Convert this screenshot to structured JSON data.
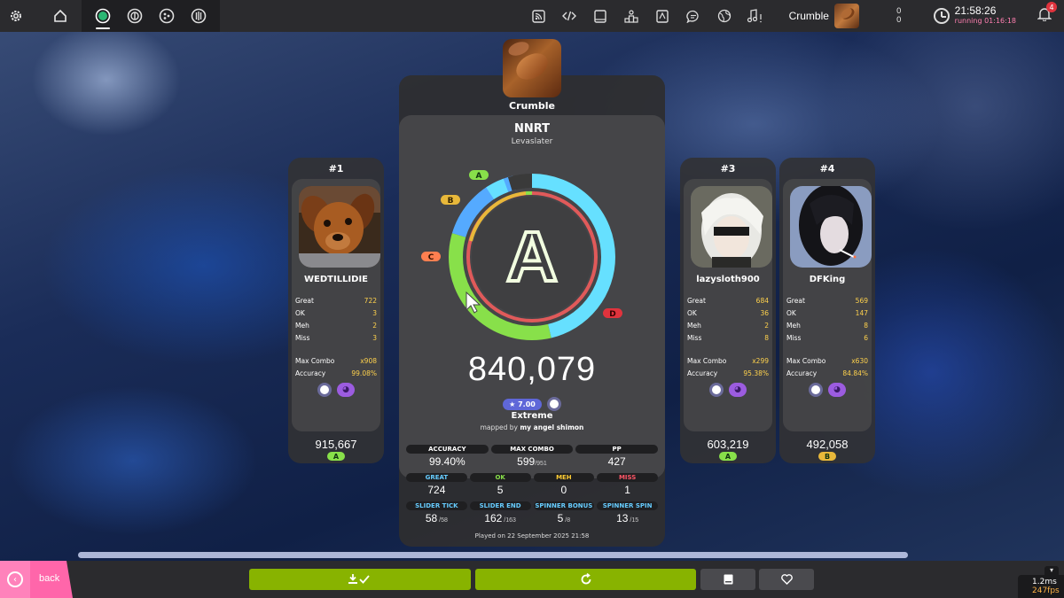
{
  "topbar": {
    "settings_icon": "gear-icon",
    "home_icon": "home-icon",
    "rulesets": [
      "osu-ruleset",
      "taiko-ruleset",
      "catch-ruleset",
      "mania-ruleset"
    ],
    "center_icons": [
      "rss-icon",
      "code-icon",
      "book-icon",
      "ranking-icon",
      "wiki-icon",
      "chat-icon",
      "globe-icon",
      "music-icon"
    ],
    "user": {
      "name": "Crumble"
    },
    "counts": [
      "0",
      "0"
    ],
    "clock": {
      "time": "21:58:26",
      "running": "running 01:16:18"
    },
    "notifications": "4"
  },
  "beatmap": {
    "cover_title": "Crumble",
    "title": "NNRT",
    "artist": "Levaslater",
    "star_rating": "★ 7.00",
    "difficulty": "Extreme",
    "mapped_by_prefix": "mapped by",
    "mapper": "my angel shimon"
  },
  "main_score": {
    "grade": "A",
    "score": "840,079",
    "accuracy_ring": 0.994,
    "grade_markers": [
      "A",
      "B",
      "C",
      "D"
    ],
    "stats_row1": [
      {
        "label": "ACCURACY",
        "value": "99.40%",
        "sub": "",
        "color": "#ffffff"
      },
      {
        "label": "MAX COMBO",
        "value": "599",
        "sub": "/951",
        "color": "#ffffff"
      },
      {
        "label": "PP",
        "value": "427",
        "sub": "",
        "color": "#ffffff"
      }
    ],
    "stats_row2": [
      {
        "label": "GREAT",
        "value": "724",
        "sub": "",
        "color": "#66ccff"
      },
      {
        "label": "OK",
        "value": "5",
        "sub": "",
        "color": "#88e04a"
      },
      {
        "label": "MEH",
        "value": "0",
        "sub": "",
        "color": "#ffcc33"
      },
      {
        "label": "MISS",
        "value": "1",
        "sub": "",
        "color": "#ff5566"
      }
    ],
    "stats_row3": [
      {
        "label": "SLIDER TICK",
        "value": "58",
        "sub": " /58",
        "color": "#66ccff"
      },
      {
        "label": "SLIDER END",
        "value": "162",
        "sub": " /163",
        "color": "#66ccff"
      },
      {
        "label": "SPINNER BONUS",
        "value": "5",
        "sub": " /8",
        "color": "#66ccff"
      },
      {
        "label": "SPINNER SPIN",
        "value": "13",
        "sub": " /15",
        "color": "#66ccff"
      }
    ],
    "played": "Played on 22 September 2025 21:58"
  },
  "leaderboard": [
    {
      "rank": "#1",
      "username": "WEDTILLIDIE",
      "great": "722",
      "ok": "3",
      "meh": "2",
      "miss": "3",
      "max_combo": "x908",
      "accuracy": "99.08%",
      "score": "915,667",
      "grade": "A",
      "grade_color": "#88e04a"
    },
    {
      "rank": "#3",
      "username": "lazysloth900",
      "great": "684",
      "ok": "36",
      "meh": "2",
      "miss": "8",
      "max_combo": "x299",
      "accuracy": "95.38%",
      "score": "603,219",
      "grade": "A",
      "grade_color": "#88e04a"
    },
    {
      "rank": "#4",
      "username": "DFKing",
      "great": "569",
      "ok": "147",
      "meh": "8",
      "miss": "6",
      "max_combo": "x630",
      "accuracy": "84.84%",
      "score": "492,058",
      "grade": "B",
      "grade_color": "#e8b83a"
    }
  ],
  "labels": {
    "great": "Great",
    "ok": "OK",
    "meh": "Meh",
    "miss": "Miss",
    "max_combo": "Max Combo",
    "accuracy": "Accuracy"
  },
  "footer": {
    "back": "back",
    "download_icon": "download-check-icon",
    "retry_icon": "retry-icon",
    "info_icon": "beatmap-info-icon",
    "favourite_icon": "heart-icon",
    "perf": [
      "1.2ms",
      "247fps"
    ]
  }
}
